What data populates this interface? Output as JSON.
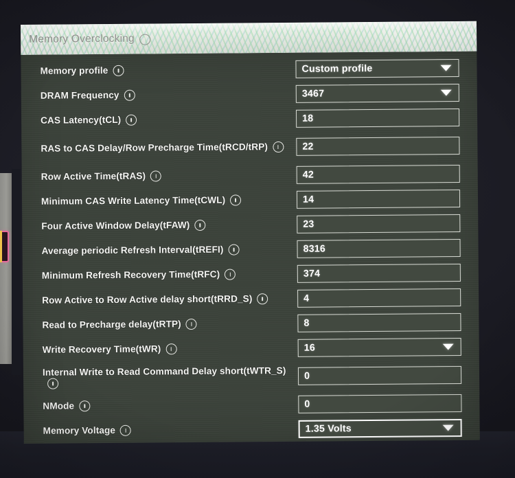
{
  "window": {
    "title": "Memory Overclocking",
    "title_info_icon": "info-icon"
  },
  "colors": {
    "panel_background": "#3b423a",
    "header_background": "#e9ece6",
    "field_background": "#424940",
    "field_border": "#d7dad3",
    "text": "#f4f5f2",
    "desktop_background": "#17171f",
    "highlight_pink": "#e86a9b",
    "highlight_yellow": "#f0c24a"
  },
  "settings": [
    {
      "label": "Memory profile",
      "value": "Custom profile",
      "control": "dropdown",
      "name": "memory-profile",
      "multiline": false,
      "emphasized": false
    },
    {
      "label": "DRAM Frequency",
      "value": "3467",
      "control": "dropdown",
      "name": "dram-frequency",
      "multiline": false,
      "emphasized": false
    },
    {
      "label": "CAS Latency(tCL)",
      "value": "18",
      "control": "text",
      "name": "cas-latency-tcl",
      "multiline": false,
      "emphasized": false
    },
    {
      "label": "RAS to CAS Delay/Row Precharge Time(tRCD/tRP)",
      "label_line1": "RAS to CAS Delay/Row Precharge",
      "label_line2": "Time(tRCD/tRP)",
      "value": "22",
      "control": "text",
      "name": "ras-to-cas-delay-trcd-trp",
      "multiline": true,
      "emphasized": false
    },
    {
      "label": "Row Active Time(tRAS)",
      "value": "42",
      "control": "text",
      "name": "row-active-time-tras",
      "multiline": false,
      "emphasized": false
    },
    {
      "label": "Minimum CAS Write Latency Time(tCWL)",
      "value": "14",
      "control": "text",
      "name": "minimum-cas-write-latency-time-tcwl",
      "multiline": false,
      "emphasized": false
    },
    {
      "label": "Four Active Window Delay(tFAW)",
      "value": "23",
      "control": "text",
      "name": "four-active-window-delay-tfaw",
      "multiline": false,
      "emphasized": false
    },
    {
      "label": "Average periodic Refresh Interval(tREFI)",
      "value": "8316",
      "control": "text",
      "name": "average-periodic-refresh-interval-trefi",
      "multiline": false,
      "emphasized": false
    },
    {
      "label": "Minimum Refresh Recovery Time(tRFC)",
      "value": "374",
      "control": "text",
      "name": "minimum-refresh-recovery-time-trfc",
      "multiline": false,
      "emphasized": false
    },
    {
      "label": "Row Active to Row Active delay short(tRRD_S)",
      "value": "4",
      "control": "text",
      "name": "row-active-to-row-active-delay-short-trrd-s",
      "multiline": false,
      "emphasized": false
    },
    {
      "label": "Read to Precharge delay(tRTP)",
      "value": "8",
      "control": "text",
      "name": "read-to-precharge-delay-trtp",
      "multiline": false,
      "emphasized": false
    },
    {
      "label": "Write Recovery Time(tWR)",
      "value": "16",
      "control": "dropdown",
      "name": "write-recovery-time-twr",
      "multiline": false,
      "emphasized": false
    },
    {
      "label": "Internal Write to Read Command Delay short(tWTR_S)",
      "label_line1": "Internal Write to Read Command Delay",
      "label_line2": "short(tWTR_S)",
      "value": "0",
      "control": "text",
      "name": "internal-write-to-read-command-delay-short-twtr-s",
      "multiline": true,
      "emphasized": false
    },
    {
      "label": "NMode",
      "value": "0",
      "control": "text",
      "name": "nmode",
      "multiline": false,
      "emphasized": false
    },
    {
      "label": "Memory Voltage",
      "value": "1.35 Volts",
      "control": "dropdown",
      "name": "memory-voltage",
      "multiline": false,
      "emphasized": true
    }
  ]
}
